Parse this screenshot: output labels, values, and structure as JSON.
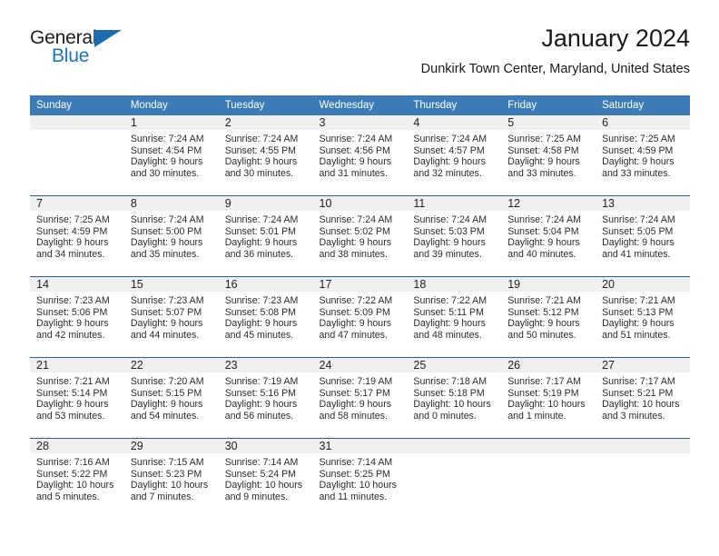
{
  "brand": {
    "name_part1": "General",
    "name_part2": "Blue",
    "logo_icon": "triangle-flag-icon"
  },
  "header": {
    "title": "January 2024",
    "subtitle": "Dunkirk Town Center, Maryland, United States"
  },
  "colors": {
    "header_blue": "#3b7cb8",
    "separator_blue": "#2a6496",
    "daynum_band": "#f0f0f0",
    "brand_blue": "#1b75bb"
  },
  "calendar": {
    "weekday_headers": [
      "Sunday",
      "Monday",
      "Tuesday",
      "Wednesday",
      "Thursday",
      "Friday",
      "Saturday"
    ],
    "weeks": [
      [
        {
          "day": "",
          "sunrise": "",
          "sunset": "",
          "daylight1": "",
          "daylight2": ""
        },
        {
          "day": "1",
          "sunrise": "Sunrise: 7:24 AM",
          "sunset": "Sunset: 4:54 PM",
          "daylight1": "Daylight: 9 hours",
          "daylight2": "and 30 minutes."
        },
        {
          "day": "2",
          "sunrise": "Sunrise: 7:24 AM",
          "sunset": "Sunset: 4:55 PM",
          "daylight1": "Daylight: 9 hours",
          "daylight2": "and 30 minutes."
        },
        {
          "day": "3",
          "sunrise": "Sunrise: 7:24 AM",
          "sunset": "Sunset: 4:56 PM",
          "daylight1": "Daylight: 9 hours",
          "daylight2": "and 31 minutes."
        },
        {
          "day": "4",
          "sunrise": "Sunrise: 7:24 AM",
          "sunset": "Sunset: 4:57 PM",
          "daylight1": "Daylight: 9 hours",
          "daylight2": "and 32 minutes."
        },
        {
          "day": "5",
          "sunrise": "Sunrise: 7:25 AM",
          "sunset": "Sunset: 4:58 PM",
          "daylight1": "Daylight: 9 hours",
          "daylight2": "and 33 minutes."
        },
        {
          "day": "6",
          "sunrise": "Sunrise: 7:25 AM",
          "sunset": "Sunset: 4:59 PM",
          "daylight1": "Daylight: 9 hours",
          "daylight2": "and 33 minutes."
        }
      ],
      [
        {
          "day": "7",
          "sunrise": "Sunrise: 7:25 AM",
          "sunset": "Sunset: 4:59 PM",
          "daylight1": "Daylight: 9 hours",
          "daylight2": "and 34 minutes."
        },
        {
          "day": "8",
          "sunrise": "Sunrise: 7:24 AM",
          "sunset": "Sunset: 5:00 PM",
          "daylight1": "Daylight: 9 hours",
          "daylight2": "and 35 minutes."
        },
        {
          "day": "9",
          "sunrise": "Sunrise: 7:24 AM",
          "sunset": "Sunset: 5:01 PM",
          "daylight1": "Daylight: 9 hours",
          "daylight2": "and 36 minutes."
        },
        {
          "day": "10",
          "sunrise": "Sunrise: 7:24 AM",
          "sunset": "Sunset: 5:02 PM",
          "daylight1": "Daylight: 9 hours",
          "daylight2": "and 38 minutes."
        },
        {
          "day": "11",
          "sunrise": "Sunrise: 7:24 AM",
          "sunset": "Sunset: 5:03 PM",
          "daylight1": "Daylight: 9 hours",
          "daylight2": "and 39 minutes."
        },
        {
          "day": "12",
          "sunrise": "Sunrise: 7:24 AM",
          "sunset": "Sunset: 5:04 PM",
          "daylight1": "Daylight: 9 hours",
          "daylight2": "and 40 minutes."
        },
        {
          "day": "13",
          "sunrise": "Sunrise: 7:24 AM",
          "sunset": "Sunset: 5:05 PM",
          "daylight1": "Daylight: 9 hours",
          "daylight2": "and 41 minutes."
        }
      ],
      [
        {
          "day": "14",
          "sunrise": "Sunrise: 7:23 AM",
          "sunset": "Sunset: 5:06 PM",
          "daylight1": "Daylight: 9 hours",
          "daylight2": "and 42 minutes."
        },
        {
          "day": "15",
          "sunrise": "Sunrise: 7:23 AM",
          "sunset": "Sunset: 5:07 PM",
          "daylight1": "Daylight: 9 hours",
          "daylight2": "and 44 minutes."
        },
        {
          "day": "16",
          "sunrise": "Sunrise: 7:23 AM",
          "sunset": "Sunset: 5:08 PM",
          "daylight1": "Daylight: 9 hours",
          "daylight2": "and 45 minutes."
        },
        {
          "day": "17",
          "sunrise": "Sunrise: 7:22 AM",
          "sunset": "Sunset: 5:09 PM",
          "daylight1": "Daylight: 9 hours",
          "daylight2": "and 47 minutes."
        },
        {
          "day": "18",
          "sunrise": "Sunrise: 7:22 AM",
          "sunset": "Sunset: 5:11 PM",
          "daylight1": "Daylight: 9 hours",
          "daylight2": "and 48 minutes."
        },
        {
          "day": "19",
          "sunrise": "Sunrise: 7:21 AM",
          "sunset": "Sunset: 5:12 PM",
          "daylight1": "Daylight: 9 hours",
          "daylight2": "and 50 minutes."
        },
        {
          "day": "20",
          "sunrise": "Sunrise: 7:21 AM",
          "sunset": "Sunset: 5:13 PM",
          "daylight1": "Daylight: 9 hours",
          "daylight2": "and 51 minutes."
        }
      ],
      [
        {
          "day": "21",
          "sunrise": "Sunrise: 7:21 AM",
          "sunset": "Sunset: 5:14 PM",
          "daylight1": "Daylight: 9 hours",
          "daylight2": "and 53 minutes."
        },
        {
          "day": "22",
          "sunrise": "Sunrise: 7:20 AM",
          "sunset": "Sunset: 5:15 PM",
          "daylight1": "Daylight: 9 hours",
          "daylight2": "and 54 minutes."
        },
        {
          "day": "23",
          "sunrise": "Sunrise: 7:19 AM",
          "sunset": "Sunset: 5:16 PM",
          "daylight1": "Daylight: 9 hours",
          "daylight2": "and 56 minutes."
        },
        {
          "day": "24",
          "sunrise": "Sunrise: 7:19 AM",
          "sunset": "Sunset: 5:17 PM",
          "daylight1": "Daylight: 9 hours",
          "daylight2": "and 58 minutes."
        },
        {
          "day": "25",
          "sunrise": "Sunrise: 7:18 AM",
          "sunset": "Sunset: 5:18 PM",
          "daylight1": "Daylight: 10 hours",
          "daylight2": "and 0 minutes."
        },
        {
          "day": "26",
          "sunrise": "Sunrise: 7:17 AM",
          "sunset": "Sunset: 5:19 PM",
          "daylight1": "Daylight: 10 hours",
          "daylight2": "and 1 minute."
        },
        {
          "day": "27",
          "sunrise": "Sunrise: 7:17 AM",
          "sunset": "Sunset: 5:21 PM",
          "daylight1": "Daylight: 10 hours",
          "daylight2": "and 3 minutes."
        }
      ],
      [
        {
          "day": "28",
          "sunrise": "Sunrise: 7:16 AM",
          "sunset": "Sunset: 5:22 PM",
          "daylight1": "Daylight: 10 hours",
          "daylight2": "and 5 minutes."
        },
        {
          "day": "29",
          "sunrise": "Sunrise: 7:15 AM",
          "sunset": "Sunset: 5:23 PM",
          "daylight1": "Daylight: 10 hours",
          "daylight2": "and 7 minutes."
        },
        {
          "day": "30",
          "sunrise": "Sunrise: 7:14 AM",
          "sunset": "Sunset: 5:24 PM",
          "daylight1": "Daylight: 10 hours",
          "daylight2": "and 9 minutes."
        },
        {
          "day": "31",
          "sunrise": "Sunrise: 7:14 AM",
          "sunset": "Sunset: 5:25 PM",
          "daylight1": "Daylight: 10 hours",
          "daylight2": "and 11 minutes."
        },
        {
          "day": "",
          "sunrise": "",
          "sunset": "",
          "daylight1": "",
          "daylight2": ""
        },
        {
          "day": "",
          "sunrise": "",
          "sunset": "",
          "daylight1": "",
          "daylight2": ""
        },
        {
          "day": "",
          "sunrise": "",
          "sunset": "",
          "daylight1": "",
          "daylight2": ""
        }
      ]
    ]
  }
}
